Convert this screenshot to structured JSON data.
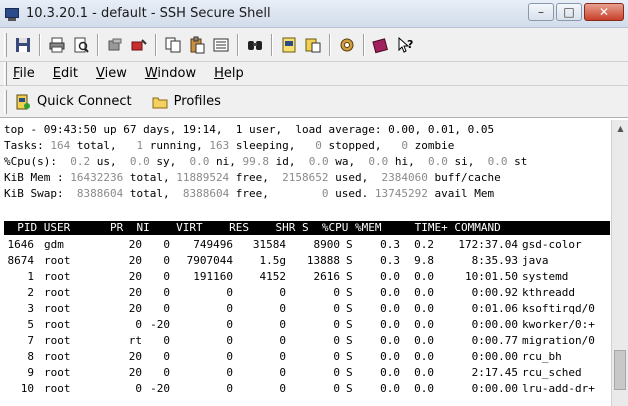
{
  "window": {
    "title": "10.3.20.1 - default - SSH Secure Shell",
    "minimize": "–",
    "maximize": "□",
    "close": "✕"
  },
  "toolbar": {
    "icons": [
      "save-icon",
      "print-icon",
      "print-preview-icon",
      "copy-icon",
      "paste-icon",
      "find-icon",
      "new-file-transfer-icon",
      "settings-icon",
      "help-icon"
    ]
  },
  "menu": {
    "items": [
      {
        "first": "F",
        "rest": "ile"
      },
      {
        "first": "E",
        "rest": "dit"
      },
      {
        "first": "V",
        "rest": "iew"
      },
      {
        "first": "W",
        "rest": "indow"
      },
      {
        "first": "H",
        "rest": "elp"
      }
    ]
  },
  "quickbar": {
    "quick_connect": "Quick Connect",
    "profiles": "Profiles"
  },
  "top": {
    "line1": "top - 09:43:50 up 67 days, 19:14,  1 user,  load average: 0.00, 0.01, 0.05",
    "line2_a": "Tasks: ",
    "line2_b": "164",
    "line2_c": " total,   ",
    "line2_d": "1",
    "line2_e": " running, ",
    "line2_f": "163",
    "line2_g": " sleeping,   ",
    "line2_h": "0",
    "line2_i": " stopped,   ",
    "line2_j": "0",
    "line2_k": " zombie",
    "line3_a": "%Cpu(s):  ",
    "line3_b": "0.2",
    "line3_c": " us,  ",
    "line3_d": "0.0",
    "line3_e": " sy,  ",
    "line3_f": "0.0",
    "line3_g": " ni, ",
    "line3_h": "99.8",
    "line3_i": " id,  ",
    "line3_j": "0.0",
    "line3_k": " wa,  ",
    "line3_l": "0.0",
    "line3_m": " hi,  ",
    "line3_n": "0.0",
    "line3_o": " si,  ",
    "line3_p": "0.0",
    "line3_q": " st",
    "line4_a": "KiB Mem : ",
    "line4_b": "16432236",
    "line4_c": " total, ",
    "line4_d": "11889524",
    "line4_e": " free,  ",
    "line4_f": "2158652",
    "line4_g": " used,  ",
    "line4_h": "2384060",
    "line4_i": " buff/cache",
    "line5_a": "KiB Swap:  ",
    "line5_b": "8388604",
    "line5_c": " total,  ",
    "line5_d": "8388604",
    "line5_e": " free,        ",
    "line5_f": "0",
    "line5_g": " used. ",
    "line5_h": "13745292",
    "line5_i": " avail Mem",
    "header": "  PID USER      PR  NI    VIRT    RES    SHR S  %CPU %MEM     TIME+ COMMAND"
  },
  "processes": [
    {
      "pid": "1646",
      "user": "gdm",
      "pr": "20",
      "ni": "0",
      "virt": "749496",
      "res": "31584",
      "shr": "8900",
      "s": "S",
      "cpu": "0.3",
      "mem": "0.2",
      "time": "172:37.04",
      "cmd": "gsd-color"
    },
    {
      "pid": "8674",
      "user": "root",
      "pr": "20",
      "ni": "0",
      "virt": "7907044",
      "res": "1.5g",
      "shr": "13888",
      "s": "S",
      "cpu": "0.3",
      "mem": "9.8",
      "time": "8:35.93",
      "cmd": "java"
    },
    {
      "pid": "1",
      "user": "root",
      "pr": "20",
      "ni": "0",
      "virt": "191160",
      "res": "4152",
      "shr": "2616",
      "s": "S",
      "cpu": "0.0",
      "mem": "0.0",
      "time": "10:01.50",
      "cmd": "systemd"
    },
    {
      "pid": "2",
      "user": "root",
      "pr": "20",
      "ni": "0",
      "virt": "0",
      "res": "0",
      "shr": "0",
      "s": "S",
      "cpu": "0.0",
      "mem": "0.0",
      "time": "0:00.92",
      "cmd": "kthreadd"
    },
    {
      "pid": "3",
      "user": "root",
      "pr": "20",
      "ni": "0",
      "virt": "0",
      "res": "0",
      "shr": "0",
      "s": "S",
      "cpu": "0.0",
      "mem": "0.0",
      "time": "0:01.06",
      "cmd": "ksoftirqd/0"
    },
    {
      "pid": "5",
      "user": "root",
      "pr": "0",
      "ni": "-20",
      "virt": "0",
      "res": "0",
      "shr": "0",
      "s": "S",
      "cpu": "0.0",
      "mem": "0.0",
      "time": "0:00.00",
      "cmd": "kworker/0:+"
    },
    {
      "pid": "7",
      "user": "root",
      "pr": "rt",
      "ni": "0",
      "virt": "0",
      "res": "0",
      "shr": "0",
      "s": "S",
      "cpu": "0.0",
      "mem": "0.0",
      "time": "0:00.77",
      "cmd": "migration/0"
    },
    {
      "pid": "8",
      "user": "root",
      "pr": "20",
      "ni": "0",
      "virt": "0",
      "res": "0",
      "shr": "0",
      "s": "S",
      "cpu": "0.0",
      "mem": "0.0",
      "time": "0:00.00",
      "cmd": "rcu_bh"
    },
    {
      "pid": "9",
      "user": "root",
      "pr": "20",
      "ni": "0",
      "virt": "0",
      "res": "0",
      "shr": "0",
      "s": "S",
      "cpu": "0.0",
      "mem": "0.0",
      "time": "2:17.45",
      "cmd": "rcu_sched"
    },
    {
      "pid": "10",
      "user": "root",
      "pr": "0",
      "ni": "-20",
      "virt": "0",
      "res": "0",
      "shr": "0",
      "s": "S",
      "cpu": "0.0",
      "mem": "0.0",
      "time": "0:00.00",
      "cmd": "lru-add-dr+"
    }
  ],
  "colors": {
    "titlebar": "#d2dcea",
    "dim_value": "#8a8a8a",
    "header_bg": "#000000"
  }
}
